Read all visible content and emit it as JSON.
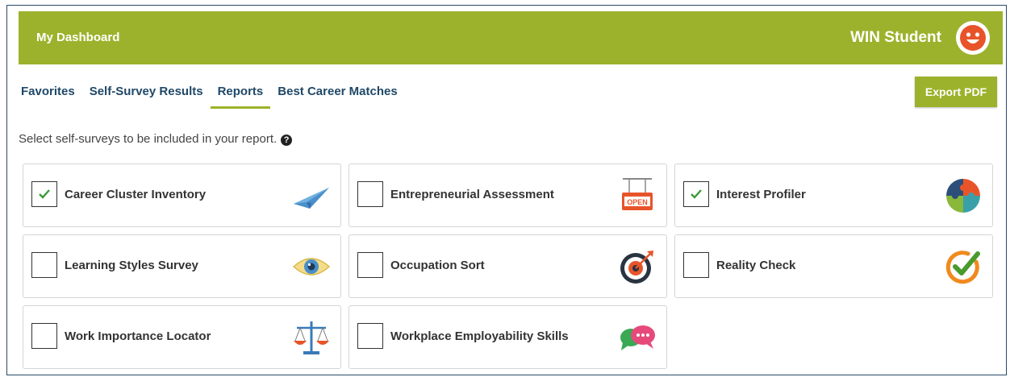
{
  "header": {
    "title": "My Dashboard",
    "user_name": "WIN Student"
  },
  "tabs": [
    {
      "label": "Favorites",
      "active": false
    },
    {
      "label": "Self-Survey Results",
      "active": false
    },
    {
      "label": "Reports",
      "active": true
    },
    {
      "label": "Best Career Matches",
      "active": false
    }
  ],
  "export_button": "Export PDF",
  "instruction": "Select self-surveys to be included in your report.",
  "surveys": [
    {
      "label": "Career Cluster Inventory",
      "checked": true,
      "icon": "paper-plane-icon"
    },
    {
      "label": "Entrepreneurial Assessment",
      "checked": false,
      "icon": "open-sign-icon"
    },
    {
      "label": "Interest Profiler",
      "checked": true,
      "icon": "puzzle-icon"
    },
    {
      "label": "Learning Styles Survey",
      "checked": false,
      "icon": "eye-icon"
    },
    {
      "label": "Occupation Sort",
      "checked": false,
      "icon": "target-icon"
    },
    {
      "label": "Reality Check",
      "checked": false,
      "icon": "checkmark-circle-icon"
    },
    {
      "label": "Work Importance Locator",
      "checked": false,
      "icon": "scales-icon"
    },
    {
      "label": "Workplace Employability Skills",
      "checked": false,
      "icon": "chat-bubbles-icon"
    }
  ],
  "colors": {
    "brand_green": "#9db22c",
    "nav_blue": "#1f4868",
    "check_green": "#3a9a3a",
    "avatar_orange": "#e8542a"
  }
}
